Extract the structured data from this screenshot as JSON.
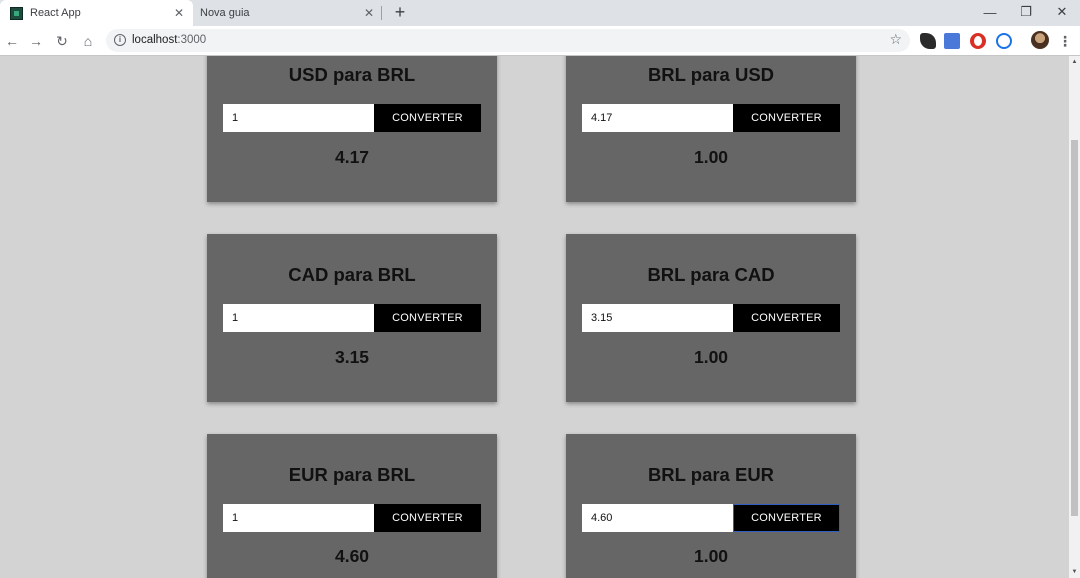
{
  "browser": {
    "tabs": [
      {
        "title": "React App",
        "close": "✕"
      },
      {
        "title": "Nova guia",
        "close": "✕"
      }
    ],
    "new_tab": "+",
    "window": {
      "minimize": "—",
      "restore": "❐",
      "close": "✕"
    },
    "nav": {
      "back": "←",
      "forward": "→",
      "reload": "↻",
      "home": "⌂"
    },
    "address": {
      "host": "localhost",
      "port": ":3000"
    },
    "bookmark": "☆",
    "menu": "⋮"
  },
  "cards": [
    {
      "title": "USD para BRL",
      "input_value": "1",
      "button_label": "CONVERTER",
      "result": "4.17"
    },
    {
      "title": "BRL para USD",
      "input_value": "4.17",
      "button_label": "CONVERTER",
      "result": "1.00"
    },
    {
      "title": "CAD para BRL",
      "input_value": "1",
      "button_label": "CONVERTER",
      "result": "3.15"
    },
    {
      "title": "BRL para CAD",
      "input_value": "3.15",
      "button_label": "CONVERTER",
      "result": "1.00"
    },
    {
      "title": "EUR para BRL",
      "input_value": "1",
      "button_label": "CONVERTER",
      "result": "4.60"
    },
    {
      "title": "BRL para EUR",
      "input_value": "4.60",
      "button_label": "CONVERTER",
      "result": "1.00"
    }
  ],
  "scrollbar": {
    "up": "▲",
    "down": "▼"
  }
}
